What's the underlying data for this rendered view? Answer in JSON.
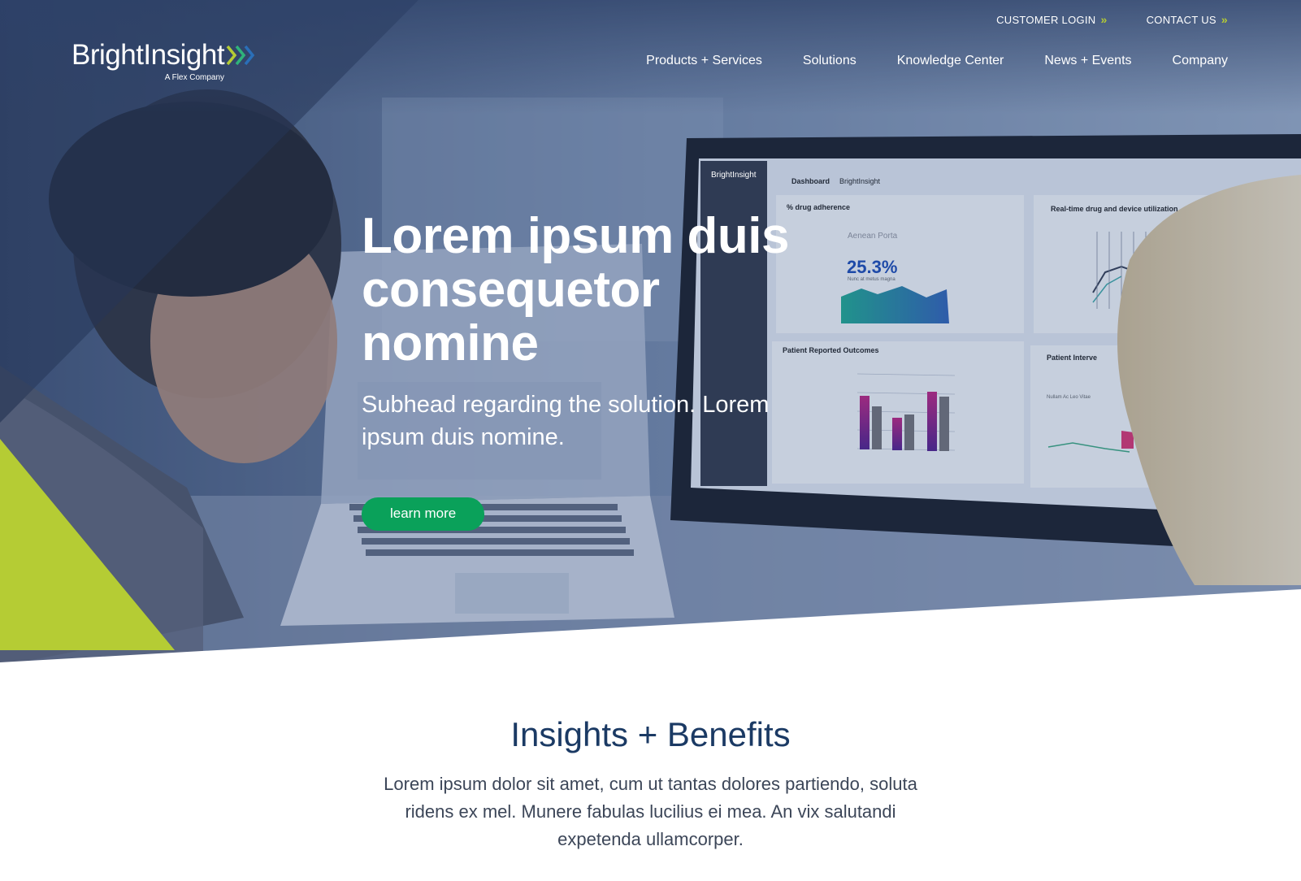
{
  "header": {
    "logo_text": "BrightInsight",
    "logo_sub": "A Flex Company",
    "top_links": [
      {
        "label": "CUSTOMER LOGIN",
        "icon": "double-chevron-right-icon"
      },
      {
        "label": "CONTACT US",
        "icon": "double-chevron-right-icon"
      }
    ],
    "nav": [
      "Products + Services",
      "Solutions",
      "Knowledge Center",
      "News + Events",
      "Company"
    ]
  },
  "hero": {
    "title": "Lorem ipsum duis consequetor nomine",
    "subhead": "Subhead regarding the solution. Lorem ipsum duis nomine.",
    "cta": "learn more"
  },
  "dashboard": {
    "brand": "BrightInsight",
    "breadcrumb": "Dashboard",
    "breadcrumb_current": "BrightInsight",
    "card1_title": "% drug adherence",
    "card1_name": "Aenean Porta",
    "card1_value": "25.3%",
    "card1_caption": "Nunc at metus magna",
    "card2_title": "Real-time drug and device utilization",
    "card3_title": "Patient Reported Outcomes",
    "card4_title": "Patient Interve",
    "card4_name": "Nullam Ac Leo Vitae"
  },
  "insights": {
    "title": "Insights + Benefits",
    "body": "Lorem ipsum dolor sit amet, cum ut tantas dolores partiendo, soluta ridens ex mel. Munere fabulas lucilius ei mea. An vix salutandi expetenda ullamcorper."
  },
  "colors": {
    "navy": "#1b3a64",
    "green_button": "#0aa15a",
    "lime_accent": "#b5cc34",
    "hero_overlay": "#2a4470"
  }
}
